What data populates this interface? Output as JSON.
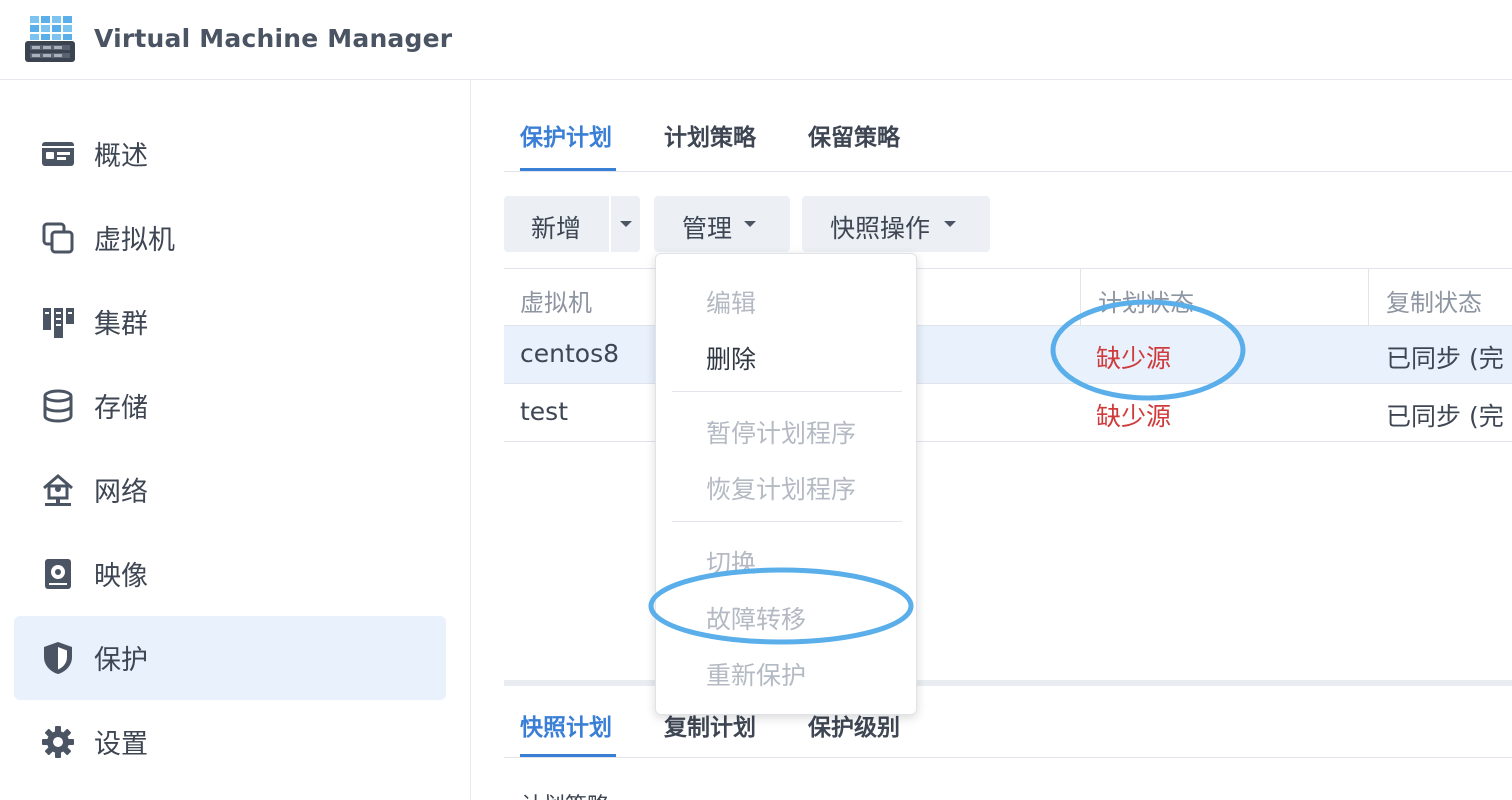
{
  "app": {
    "title": "Virtual Machine Manager"
  },
  "sidebar": {
    "items": [
      {
        "label": "概述",
        "icon": "overview-card-icon",
        "active": false
      },
      {
        "label": "虚拟机",
        "icon": "vm-copy-icon",
        "active": false
      },
      {
        "label": "集群",
        "icon": "cluster-icon",
        "active": false
      },
      {
        "label": "存储",
        "icon": "storage-database-icon",
        "active": false
      },
      {
        "label": "网络",
        "icon": "network-icon",
        "active": false
      },
      {
        "label": "映像",
        "icon": "image-disk-icon",
        "active": false
      },
      {
        "label": "保护",
        "icon": "shield-icon",
        "active": true
      },
      {
        "label": "设置",
        "icon": "gear-icon",
        "active": false
      }
    ]
  },
  "tabs": [
    {
      "label": "保护计划",
      "active": true
    },
    {
      "label": "计划策略",
      "active": false
    },
    {
      "label": "保留策略",
      "active": false
    }
  ],
  "toolbar": {
    "add_label": "新增",
    "manage_label": "管理",
    "snapshot_label": "快照操作"
  },
  "table": {
    "columns": [
      "虚拟机",
      "计划状态",
      "复制状态"
    ],
    "rows": [
      {
        "vm": "centos8",
        "plan_status": "缺少源",
        "replication_status": "已同步 (完",
        "selected": true
      },
      {
        "vm": "test",
        "plan_status": "缺少源",
        "replication_status": "已同步 (完",
        "selected": false
      }
    ]
  },
  "manage_menu": {
    "groups": [
      [
        {
          "label": "编辑",
          "enabled": false
        },
        {
          "label": "删除",
          "enabled": true
        }
      ],
      [
        {
          "label": "暂停计划程序",
          "enabled": false
        },
        {
          "label": "恢复计划程序",
          "enabled": false
        }
      ],
      [
        {
          "label": "切换",
          "enabled": false
        },
        {
          "label": "故障转移",
          "enabled": false
        },
        {
          "label": "重新保护",
          "enabled": false
        }
      ]
    ]
  },
  "bottom_tabs": [
    {
      "label": "快照计划",
      "active": true
    },
    {
      "label": "复制计划",
      "active": false
    },
    {
      "label": "保护级别",
      "active": false
    }
  ],
  "bottom_panel": {
    "sub_label": "计划策略"
  },
  "colors": {
    "accent": "#3a7fd6",
    "status_error": "#cf3b3b",
    "annotation": "#5aaeea",
    "selected_bg": "#e8f1fc"
  }
}
